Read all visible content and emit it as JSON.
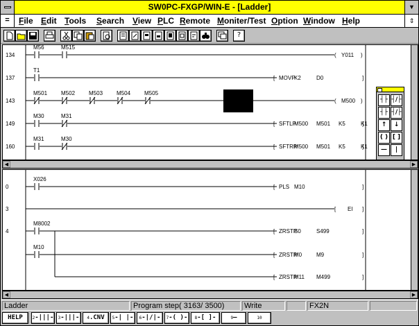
{
  "window": {
    "title": "SW0PC-FXGP/WIN-E - [Ladder]",
    "sys_menu_glyph": "=",
    "min_glyph": "▼",
    "restore_glyph": "⇕"
  },
  "menu": [
    {
      "label": "File"
    },
    {
      "label": "Edit"
    },
    {
      "label": "Tools"
    },
    {
      "label": "Search"
    },
    {
      "label": "View"
    },
    {
      "label": "PLC"
    },
    {
      "label": "Remote"
    },
    {
      "label": "Moniter/Test"
    },
    {
      "label": "Option"
    },
    {
      "label": "Window"
    },
    {
      "label": "Help"
    }
  ],
  "toolbar": {
    "icons": [
      "new-icon",
      "open-icon",
      "save-icon",
      "print-icon",
      "cut-icon",
      "copy-icon",
      "paste-icon",
      "print-preview-icon",
      "page-icon-1",
      "page-icon-2",
      "page-icon-3",
      "page-icon-4",
      "page-icon-5",
      "page-icon-6",
      "page-icon-7",
      "find-icon",
      "window-icon",
      "help-icon"
    ]
  },
  "ladder_upper": {
    "rungs": [
      {
        "step": "134",
        "contacts": [
          "M56",
          "M515"
        ],
        "coil": "Y011"
      },
      {
        "step": "137",
        "contacts": [
          "T1"
        ],
        "instruction": [
          "MOVP",
          "K2",
          "D0"
        ]
      },
      {
        "step": "143",
        "contacts": [
          "M501",
          "M502",
          "M503",
          "M504",
          "M505"
        ],
        "coil": "M500"
      },
      {
        "step": "149",
        "contacts": [
          "M30",
          "M31"
        ],
        "instruction": [
          "SFTLP",
          "M500",
          "M501",
          "K5",
          "K1"
        ]
      },
      {
        "step": "160",
        "contacts": [
          "M31",
          "M30"
        ],
        "instruction": [
          "SFTRP",
          "M500",
          "M501",
          "K5",
          "K1"
        ]
      }
    ]
  },
  "ladder_lower": {
    "rungs": [
      {
        "step": "0",
        "contacts": [
          "X026"
        ],
        "instruction": [
          "PLS",
          "M10"
        ]
      },
      {
        "step": "3",
        "instruction": [
          "EI"
        ]
      },
      {
        "step": "4",
        "contacts": [
          "M8002",
          "M10"
        ],
        "instruction": [
          "ZRSTP",
          "S0",
          "S499"
        ]
      },
      {
        "instruction": [
          "ZRSTP",
          "M0",
          "M9"
        ]
      },
      {
        "instruction": [
          "ZRSTP",
          "M11",
          "M499"
        ]
      }
    ]
  },
  "status": {
    "mode": "Ladder",
    "program_step": "Program step( 3163/ 3500)",
    "access": "Write",
    "plc": "FX2N"
  },
  "fkeys": [
    {
      "label": "HELP",
      "num": ""
    },
    {
      "label": "-|||-",
      "num": "2"
    },
    {
      "label": "-|||-",
      "num": "3"
    },
    {
      "label": ".CNV",
      "num": "4"
    },
    {
      "label": "-| |-",
      "num": "5"
    },
    {
      "label": "-|/|-",
      "num": "6"
    },
    {
      "label": "-( )-",
      "num": "7"
    },
    {
      "label": "-[ ]-",
      "num": "8"
    },
    {
      "label": "—",
      "num": "9"
    },
    {
      "label": "",
      "num": "10"
    }
  ]
}
